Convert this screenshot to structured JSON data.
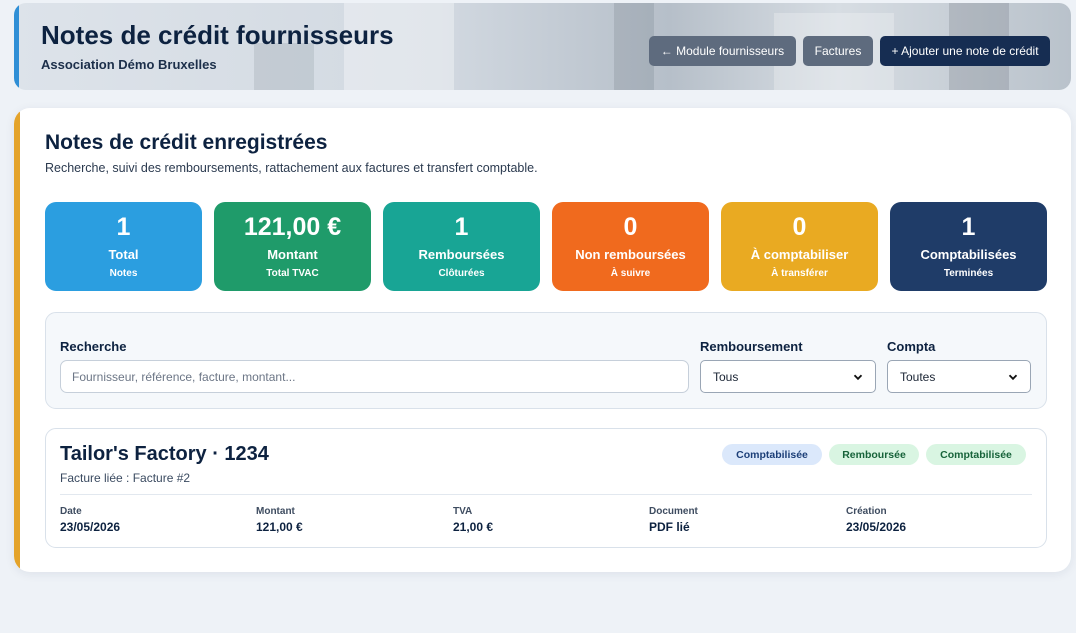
{
  "header": {
    "title": "Notes de crédit fournisseurs",
    "organization": "Association Démo Bruxelles",
    "buttons": {
      "suppliers": "← Module fournisseurs",
      "invoices": "Factures",
      "add": "+ Ajouter une note de crédit"
    }
  },
  "section": {
    "title": "Notes de crédit enregistrées",
    "description": "Recherche, suivi des remboursements, rattachement aux factures et transfert comptable."
  },
  "stats": [
    {
      "value": "1",
      "label": "Total",
      "sub": "Notes",
      "color": "#2b9ee0"
    },
    {
      "value": "121,00 €",
      "label": "Montant",
      "sub": "Total TVAC",
      "color": "#1f9b6a"
    },
    {
      "value": "1",
      "label": "Remboursées",
      "sub": "Clôturées",
      "color": "#18a595"
    },
    {
      "value": "0",
      "label": "Non remboursées",
      "sub": "À suivre",
      "color": "#f06a1e"
    },
    {
      "value": "0",
      "label": "À comptabiliser",
      "sub": "À transférer",
      "color": "#e9aa22"
    },
    {
      "value": "1",
      "label": "Comptabilisées",
      "sub": "Terminées",
      "color": "#1f3c68"
    }
  ],
  "filters": {
    "search": {
      "label": "Recherche",
      "placeholder": "Fournisseur, référence, facture, montant..."
    },
    "reimbursement": {
      "label": "Remboursement",
      "selected": "Tous"
    },
    "accounting": {
      "label": "Compta",
      "selected": "Toutes"
    }
  },
  "records": [
    {
      "title": "Tailor's Factory · 1234",
      "invoice_link": "Facture liée : Facture #2",
      "badges": [
        "Comptabilisée",
        "Remboursée",
        "Comptabilisée"
      ],
      "fields": [
        {
          "label": "Date",
          "value": "23/05/2026"
        },
        {
          "label": "Montant",
          "value": "121,00 €"
        },
        {
          "label": "TVA",
          "value": "21,00 €"
        },
        {
          "label": "Document",
          "value": "PDF lié"
        },
        {
          "label": "Création",
          "value": "23/05/2026"
        }
      ]
    }
  ]
}
